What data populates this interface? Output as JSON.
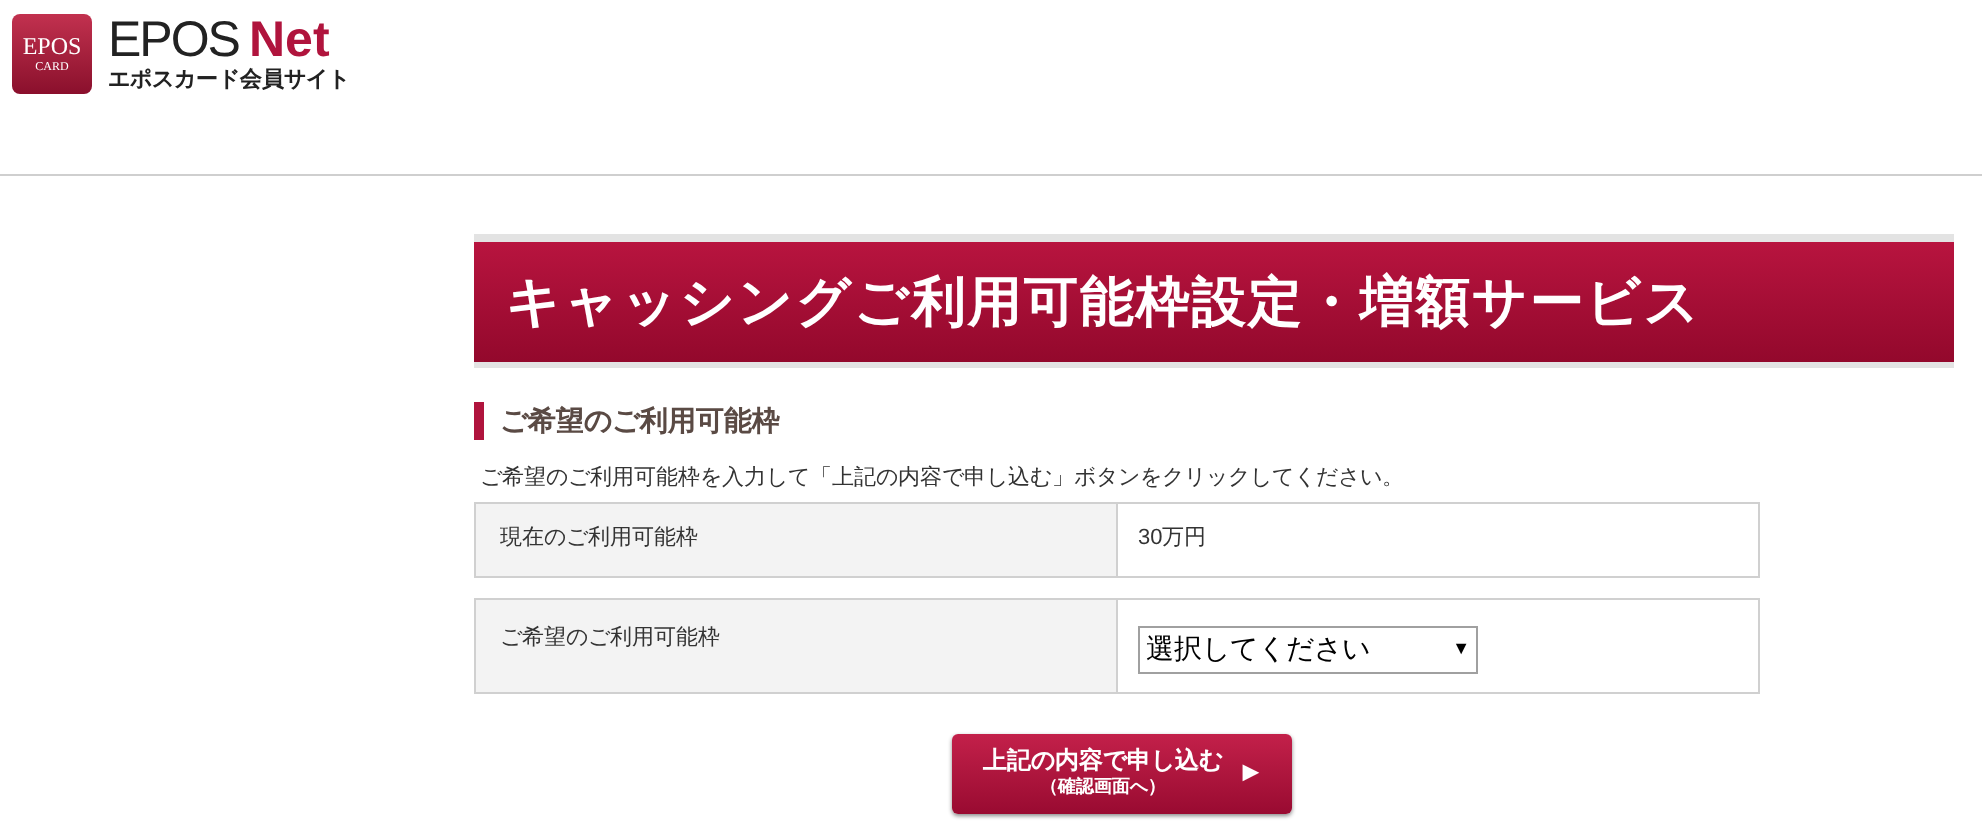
{
  "logo": {
    "badge_top": "EPOS",
    "badge_bottom": "CARD",
    "name": "EPOS",
    "name_accent": "Net",
    "subtitle": "エポスカード会員サイト"
  },
  "page_title": "キャッシングご利用可能枠設定・増額サービス",
  "section_heading": "ご希望のご利用可能枠",
  "instruction": "ご希望のご利用可能枠を入力して「上記の内容で申し込む」ボタンをクリックしてください。",
  "rows": [
    {
      "kind": "text",
      "label": "現在のご利用可能枠",
      "value": "30万円"
    },
    {
      "kind": "select",
      "label": "ご希望のご利用可能枠",
      "value": "選択してください",
      "caret": "▼"
    }
  ],
  "submit": {
    "label": "上記の内容で申し込む",
    "sublabel": "（確認画面へ）",
    "arrow": "▶"
  }
}
